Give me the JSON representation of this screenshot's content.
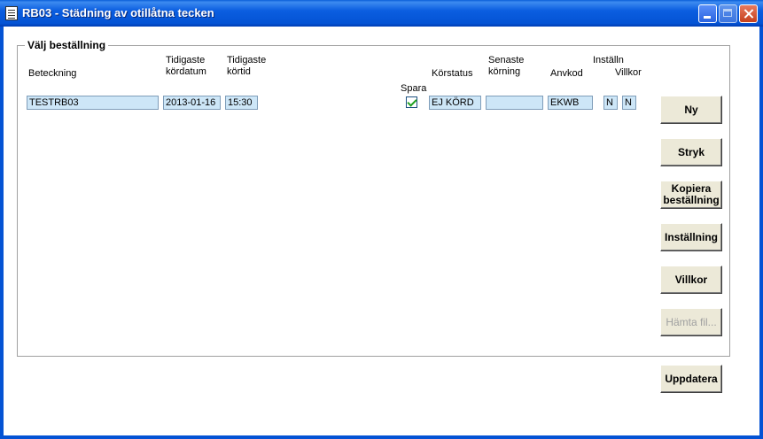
{
  "window": {
    "title": "RB03 - Städning av otillåtna tecken"
  },
  "group": {
    "legend": "Välj beställning"
  },
  "headers": {
    "beteckning": "Beteckning",
    "tidigaste_kordatum_1": "Tidigaste",
    "tidigaste_kordatum_2": "kördatum",
    "tidigaste_kortid_1": "Tidigaste",
    "tidigaste_kortid_2": "körtid",
    "spara": "Spara",
    "korstatus": "Körstatus",
    "senaste_korning_1": "Senaste",
    "senaste_korning_2": "körning",
    "anvkod": "Anvkod",
    "installn": "Inställn",
    "villkor": "Villkor"
  },
  "row": {
    "beteckning": "TESTRB03",
    "kordatum": "2013-01-16",
    "kortid": "15:30",
    "spara": true,
    "korstatus": "EJ KÖRD",
    "senaste_korning": "",
    "anvkod": "EKWB",
    "installn": "N",
    "villkor": "N"
  },
  "buttons": {
    "ny": "Ny",
    "stryk": "Stryk",
    "kopiera_1": "Kopiera",
    "kopiera_2": "beställning",
    "installning": "Inställning",
    "villkor": "Villkor",
    "hamta_fil": "Hämta fil...",
    "uppdatera": "Uppdatera"
  }
}
